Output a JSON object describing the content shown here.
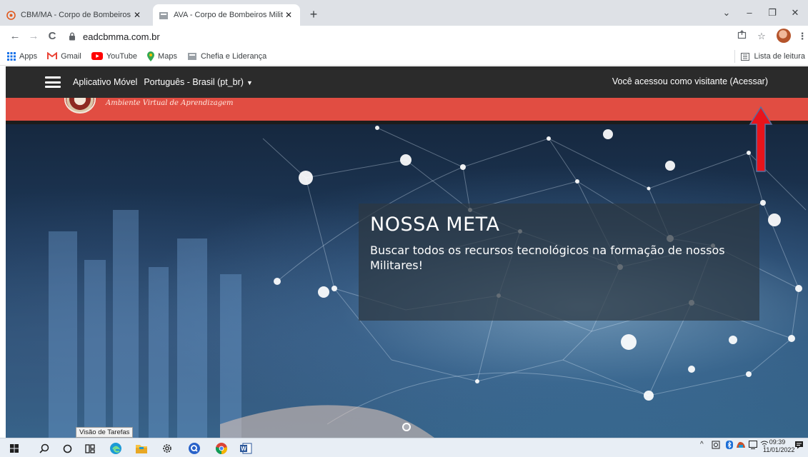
{
  "browser": {
    "tabs": [
      {
        "title": "CBM/MA - Corpo de Bombeiros",
        "close": "✕",
        "favicon": "cbm-favicon-icon"
      },
      {
        "title": "AVA - Corpo de Bombeiros Milita",
        "close": "✕",
        "favicon": "ava-favicon-icon"
      }
    ],
    "new_tab": "+",
    "window_controls": {
      "dropdown": "⌄",
      "minimize": "–",
      "restore": "❐",
      "close": "✕"
    },
    "nav": {
      "back": "←",
      "forward": "→",
      "reload": "C"
    },
    "address": "eadcbmma.com.br",
    "bookmarks": [
      {
        "label": "Apps",
        "icon": "apps-grid-icon"
      },
      {
        "label": "Gmail",
        "icon": "gmail-icon"
      },
      {
        "label": "YouTube",
        "icon": "youtube-icon"
      },
      {
        "label": "Maps",
        "icon": "maps-pin-icon"
      },
      {
        "label": "Chefia e Liderança",
        "icon": "page-icon"
      }
    ],
    "reading_list": "Lista de leitura"
  },
  "site": {
    "menu": {
      "app_link": "Aplicativo Móvel",
      "language": "Português - Brasil (pt_br)",
      "language_caret": "▼",
      "login_status": "Você acessou como visitante (Acessar)"
    },
    "tagline": "Ambiente Virtual de Aprendizagem",
    "hero": {
      "title": "NOSSA META",
      "text": "Buscar todos os recursos tecnológicos na formação de nossos Militares!"
    },
    "annotation_arrow_color": "#e8141b",
    "brand_red": "#e14d42",
    "nav_dark": "#2b2b2b"
  },
  "taskbar": {
    "tooltip": "Visão de Tarefas",
    "time": "09:39",
    "date": "11/01/2022"
  }
}
